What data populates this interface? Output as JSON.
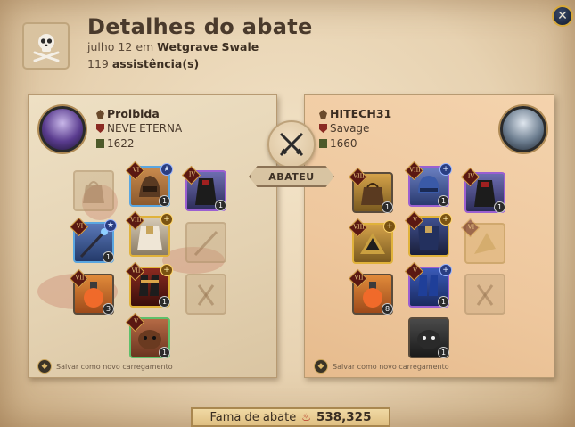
{
  "header": {
    "title": "Detalhes do abate",
    "date": "julho 12",
    "date_connector": "em",
    "location": "Wetgrave Swale",
    "assists_count": "119",
    "assists_label": "assistência(s)"
  },
  "killer": {
    "name": "Proibida",
    "guild": "NEVE ETERNA",
    "ip": "1622",
    "save_loadout": "Salvar como novo carregamento"
  },
  "victim": {
    "name": "HITECH31",
    "guild": "Savage",
    "ip": "1660",
    "save_loadout": "Salvar como novo carregamento"
  },
  "center": {
    "verb": "ABATEU"
  },
  "fame": {
    "label": "Fama de abate",
    "value": "538,325"
  },
  "killer_items": {
    "head_tier": "VI",
    "armor_tier": "VIII",
    "mainhand_tier": "VI",
    "shoes_tier": "VII",
    "mount_tier": "V",
    "potion_tier": "VII",
    "cape_tier": "IV",
    "q1": "1",
    "q2": "1",
    "q3": "1",
    "q4": "3",
    "q5": "1",
    "q6": "1",
    "q7": "1"
  },
  "victim_items": {
    "head_tier": "VIII",
    "armor_tier": "V",
    "mainhand_tier": "VIII",
    "shoes_tier": "V",
    "offhand_tier": "VI",
    "potion_tier": "VII",
    "cape_tier": "IV",
    "bag_tier": "VIII",
    "q1": "1",
    "q2": "1",
    "q3": "1",
    "q4": "1",
    "q5": "8",
    "q6": "1",
    "q7": "1",
    "q8": "1"
  },
  "colors": {
    "parchment": "#e7d2b1",
    "killer_panel": "#e4d2b2",
    "victim_panel": "#eec79d",
    "quality_blue": "#5aa6e0",
    "quality_purple": "#9b5fd1",
    "quality_gold": "#e0b23a",
    "quality_green": "#5fbf6a"
  }
}
